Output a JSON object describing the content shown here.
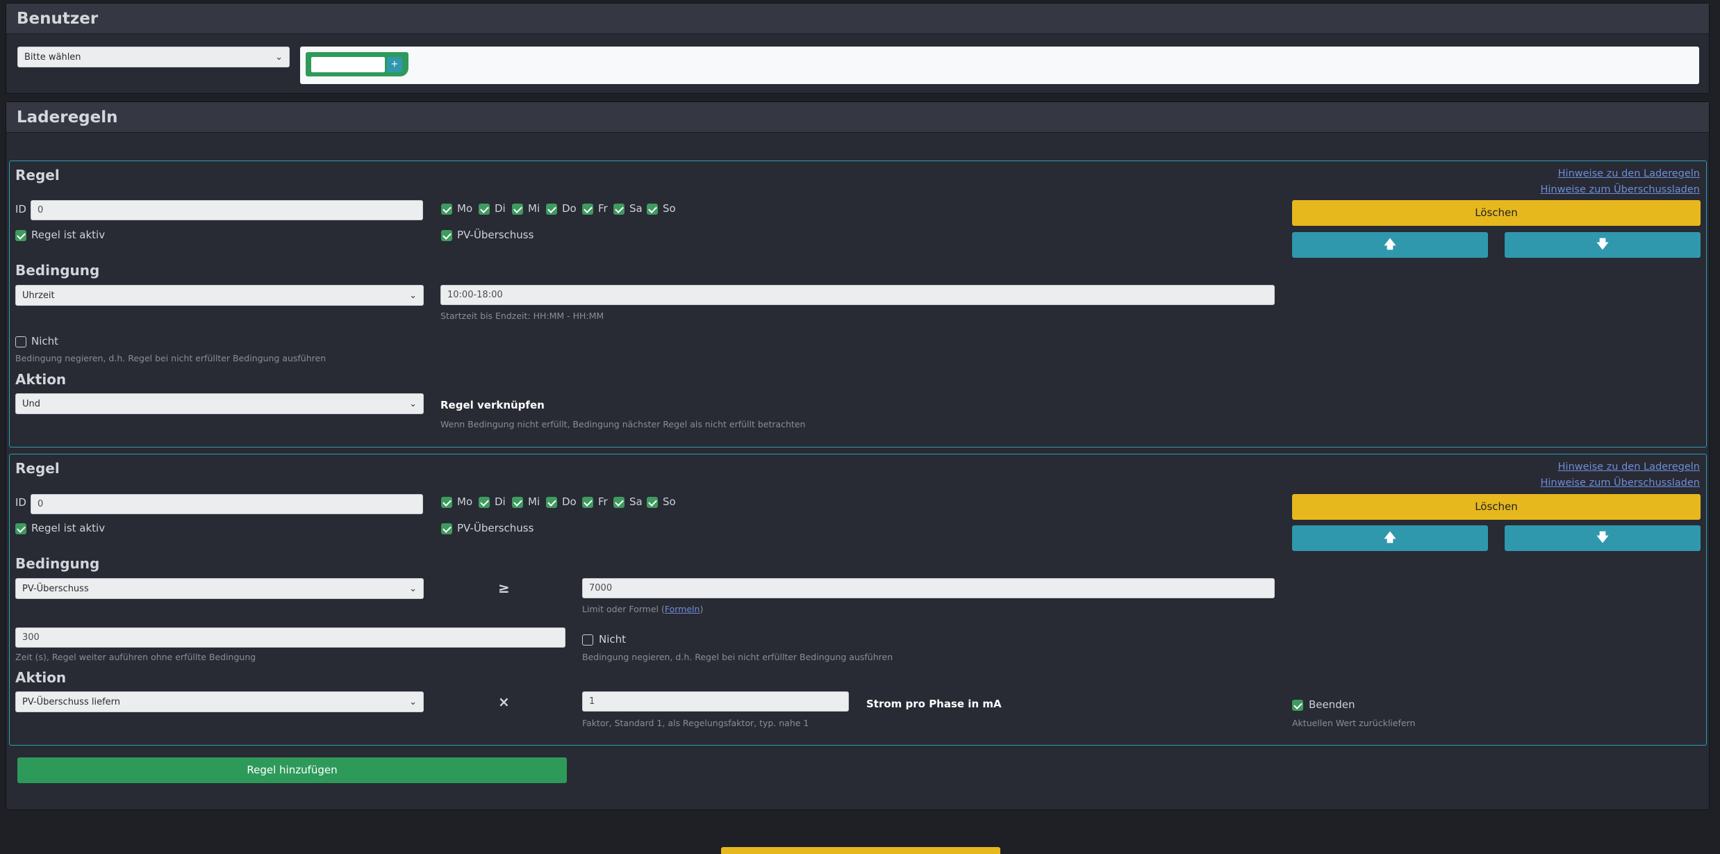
{
  "benutzer": {
    "title": "Benutzer",
    "select_value": "Bitte wählen",
    "add_button": "+"
  },
  "laderegeln": {
    "title": "Laderegeln"
  },
  "rule1": {
    "heading": "Regel",
    "link_laderegeln": "Hinweise zu den Laderegeln",
    "link_ueberschuss": "Hinweise zum Überschussladen",
    "id_label": "ID",
    "id_value": "0",
    "days": [
      "Mo",
      "Di",
      "Mi",
      "Do",
      "Fr",
      "Sa",
      "So"
    ],
    "active_label": "Regel ist aktiv",
    "pv_label": "PV-Überschuss",
    "delete_button": "Löschen",
    "up_icon": "arrow-up-icon",
    "down_icon": "arrow-down-icon",
    "bedingung_heading": "Bedingung",
    "bedingung_select": "Uhrzeit",
    "time_value": "10:00-18:00",
    "time_hint": "Startzeit bis Endzeit: HH:MM - HH:MM",
    "nicht_label": "Nicht",
    "nicht_hint": "Bedingung negieren, d.h. Regel bei nicht erfüllter Bedingung ausführen",
    "aktion_heading": "Aktion",
    "aktion_select": "Und",
    "verknuepfen_label": "Regel verknüpfen",
    "verknuepfen_hint": "Wenn Bedingung nicht erfüllt, Bedingung nächster Regel als nicht erfüllt betrachten"
  },
  "rule2": {
    "heading": "Regel",
    "link_laderegeln": "Hinweise zu den Laderegeln",
    "link_ueberschuss": "Hinweise zum Überschussladen",
    "id_label": "ID",
    "id_value": "0",
    "days": [
      "Mo",
      "Di",
      "Mi",
      "Do",
      "Fr",
      "Sa",
      "So"
    ],
    "active_label": "Regel ist aktiv",
    "pv_label": "PV-Überschuss",
    "delete_button": "Löschen",
    "bedingung_heading": "Bedingung",
    "bedingung_select": "PV-Überschuss",
    "operator": "≥",
    "limit_value": "7000",
    "limit_hint_pre": "Limit oder Formel (",
    "limit_hint_link": "Formeln",
    "limit_hint_post": ")",
    "time_value": "300",
    "time_hint": "Zeit (s), Regel weiter auführen ohne erfüllte Bedingung",
    "nicht_label": "Nicht",
    "nicht_hint": "Bedingung negieren, d.h. Regel bei nicht erfüllter Bedingung ausführen",
    "aktion_heading": "Aktion",
    "aktion_select": "PV-Überschuss liefern",
    "multiply": "×",
    "factor_value": "1",
    "factor_hint": "Faktor, Standard 1, als Regelungsfaktor, typ. nahe 1",
    "strom_label": "Strom pro Phase in mA",
    "beenden_label": "Beenden",
    "beenden_hint": "Aktuellen Wert zurückliefern"
  },
  "add_rule_button": "Regel hinzufügen",
  "colors": {
    "background": "#1e2026",
    "panel": "#282a34",
    "accent_cyan": "#2f98ac",
    "accent_yellow": "#e6b81d",
    "accent_green": "#2e9a5a"
  }
}
